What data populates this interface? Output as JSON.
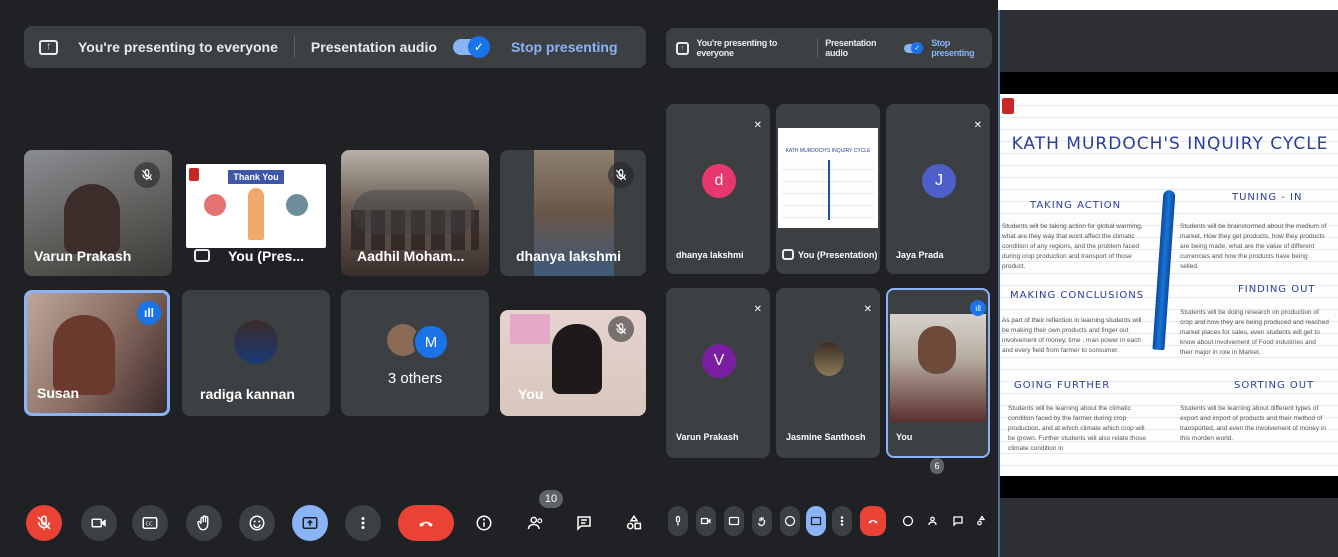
{
  "left": {
    "banner": {
      "text": "You're presenting to everyone",
      "audio_label": "Presentation audio",
      "stop_label": "Stop presenting"
    },
    "tiles": [
      {
        "name": "Varun Prakash"
      },
      {
        "name": "You (Pres..."
      },
      {
        "name": "Aadhil Moham..."
      },
      {
        "name": "dhanya lakshmi"
      },
      {
        "name": "Susan"
      },
      {
        "name": "radiga kannan"
      },
      {
        "name": "3 others",
        "avatar_letter": "M"
      },
      {
        "name": "You"
      }
    ],
    "thank_you_text": "Thank You",
    "participants_count": "10"
  },
  "middle": {
    "banner": {
      "text": "You're presenting to everyone",
      "audio_label": "Presentation audio",
      "stop_label": "Stop presenting"
    },
    "tiles": [
      {
        "name": "dhanya lakshmi",
        "letter": "d",
        "color": "#e8366e"
      },
      {
        "name": "You (Presentation)"
      },
      {
        "name": "Jaya Prada",
        "letter": "J",
        "color": "#4f5fc9"
      },
      {
        "name": "Varun Prakash",
        "letter": "V",
        "color": "#7b1fa2"
      },
      {
        "name": "Jasmine Santhosh"
      },
      {
        "name": "You"
      }
    ],
    "participants_count": "6"
  },
  "slide": {
    "title": "KATH MURDOCH'S INQUIRY CYCLE",
    "taking_action": "TAKING ACTION",
    "tuning_in": "TUNING - IN",
    "making_conclusions": "MAKING CONCLUSIONS",
    "finding_out": "FINDING OUT",
    "going_further": "GOING FURTHER",
    "sorting_out": "SORTING OUT",
    "p1": "Students will be taking action for global warming, what are they way that wont affect the climatic condition of any regions, and the problem faced during crop production and transport of those product.",
    "p2": "Students will be brainstormed about the medium of market, How they get products, how they products are being made, what are the value of different currencies and how the products have being selled.",
    "p3": "As part of their reflection in learning students will be making their own products and finger out involvement of money, time , man power in each and every field from farmer to consumer.",
    "p4": "Students will be doing research on production of crop and how they are being produced and reached market places for sales, even students will get to know about involvement of Food industries and their major in role in Market.",
    "p5": "Students will be learning about the climatic condition faced by the farmer during crop production, and at which climate which crop will be grown. Further students will also relate those climate condition in",
    "p6": "Students will be learning about different types of export and import of products and their method of transported, and even the involvement of money in this morden world."
  },
  "colors": {
    "accent": "#8ab4f8",
    "end_call": "#ea4335",
    "mic_off": "#ea4335",
    "present_active": "#8ab4f8"
  }
}
